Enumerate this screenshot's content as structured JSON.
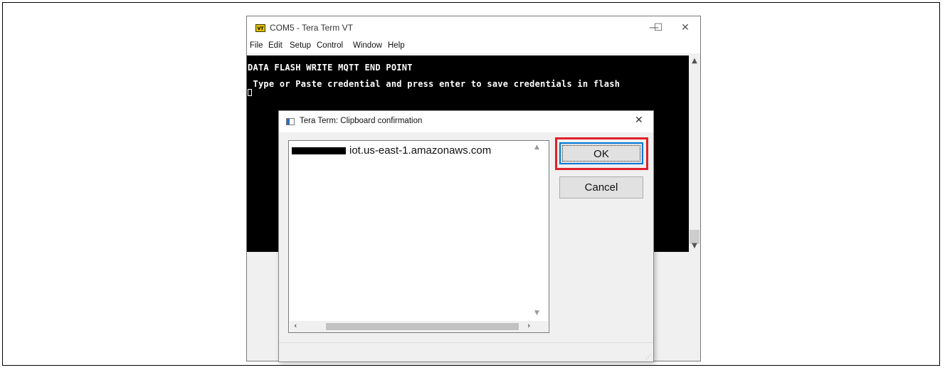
{
  "main_window": {
    "title": "COM5 - Tera Term VT",
    "app_icon_label": "VT",
    "menu": [
      "File",
      "Edit",
      "Setup",
      "Control",
      "Window",
      "Help"
    ],
    "controls": {
      "minimize": "—",
      "maximize": "☐",
      "close": "✕"
    },
    "terminal_lines": [
      "DATA FLASH WRITE MQTT END POINT",
      " Type or Paste credential and press enter to save credentials in flash"
    ]
  },
  "dialog": {
    "title": "Tera Term: Clipboard confirmation",
    "close_glyph": "✕",
    "clipboard_text": "iot.us-east-1.amazonaws.com",
    "ok_label": "OK",
    "cancel_label": "Cancel"
  },
  "colors": {
    "highlight": "#e0202a",
    "focus_border": "#0078d7",
    "terminal_bg": "#000000"
  }
}
